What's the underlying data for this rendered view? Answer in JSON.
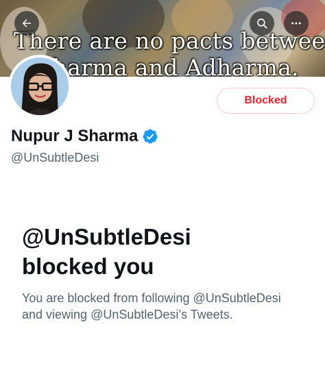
{
  "banner": {
    "line1": "There are no pacts between",
    "line2": "Dharma and Adharma."
  },
  "nav": {
    "back_icon": "back-arrow-icon",
    "search_icon": "search-icon",
    "more_icon": "more-icon"
  },
  "profile": {
    "display_name": "Nupur J Sharma",
    "handle": "@UnSubtleDesi",
    "verified": true,
    "verified_color": "#1d9bf0"
  },
  "action_button": {
    "label": "Blocked",
    "color": "#f4212e"
  },
  "blocked_notice": {
    "title_line1": "@UnSubtleDesi",
    "title_line2": "blocked you",
    "description": "You are blocked from following @UnSubtleDesi and viewing @UnSubtleDesi’s Tweets."
  }
}
